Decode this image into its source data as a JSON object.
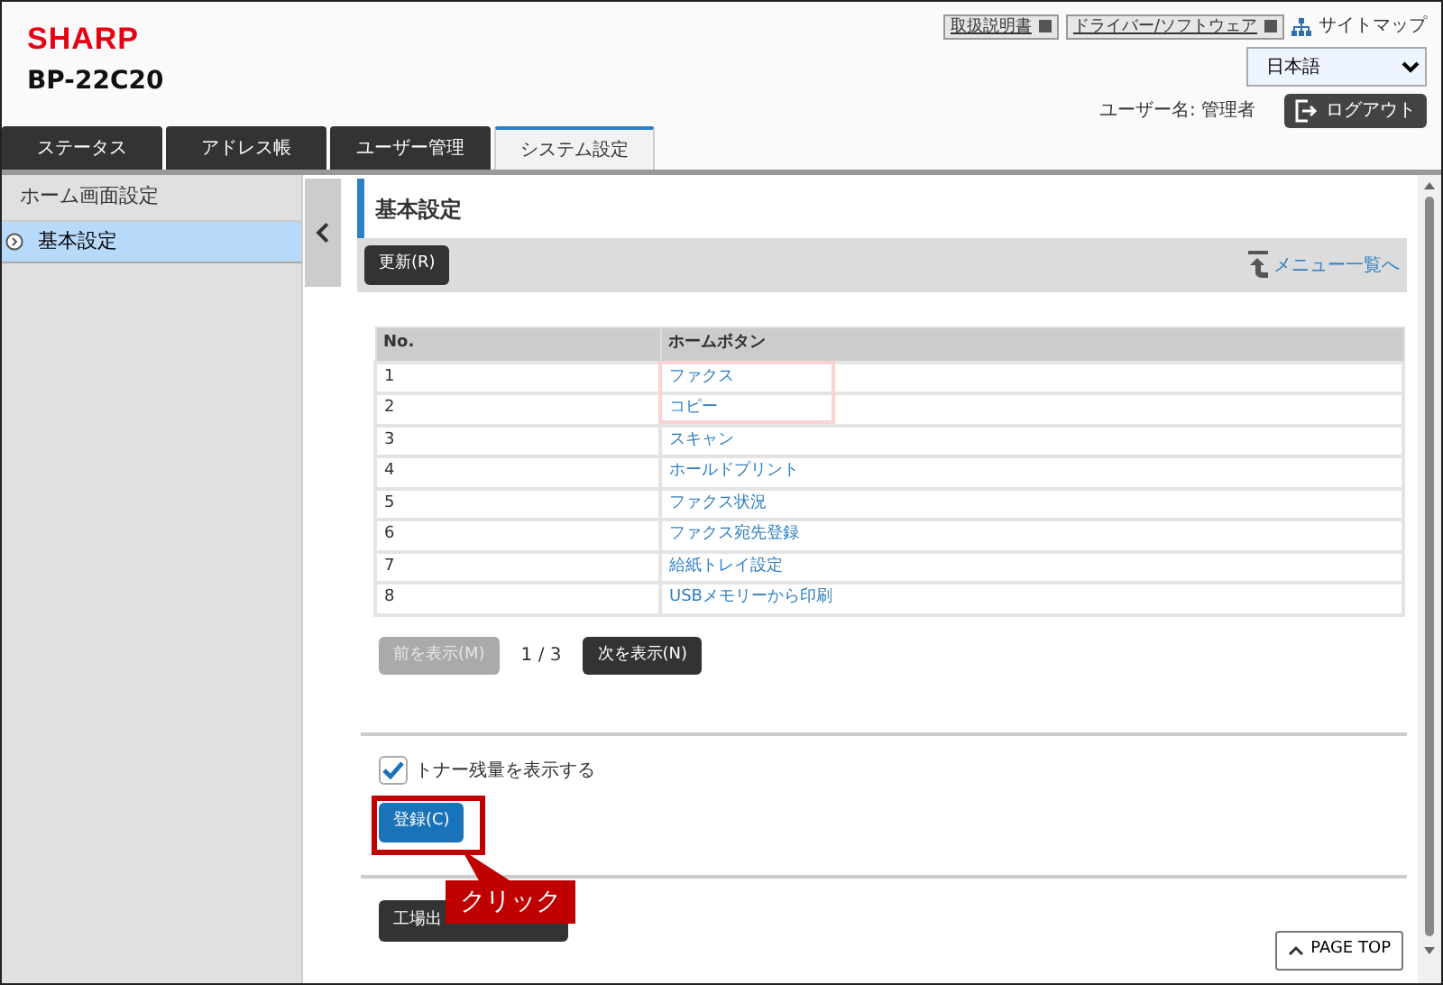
{
  "header": {
    "logo": "SHARP",
    "model": "BP-22C20",
    "links": [
      {
        "label": "取扱説明書"
      },
      {
        "label": "ドライバー/ソフトウェア"
      }
    ],
    "sitemap": "サイトマップ",
    "language": "日本語",
    "user_label": "ユーザー名: 管理者",
    "logout": "ログアウト"
  },
  "tabs": [
    {
      "label": "ステータス",
      "selected": false
    },
    {
      "label": "アドレス帳",
      "selected": false
    },
    {
      "label": "ユーザー管理",
      "selected": false
    },
    {
      "label": "システム設定",
      "selected": true
    }
  ],
  "sidebar": {
    "heading": "ホーム画面設定",
    "items": [
      {
        "label": "基本設定",
        "selected": true
      }
    ]
  },
  "page": {
    "title": "基本設定",
    "refresh": "更新(R)",
    "menu_link": "メニュー一覧へ",
    "table": {
      "columns": [
        "No.",
        "ホームボタン"
      ],
      "rows": [
        [
          "1",
          "ファクス"
        ],
        [
          "2",
          "コピー"
        ],
        [
          "3",
          "スキャン"
        ],
        [
          "4",
          "ホールドプリント"
        ],
        [
          "5",
          "ファクス状況"
        ],
        [
          "6",
          "ファクス宛先登録"
        ],
        [
          "7",
          "給紙トレイ設定"
        ],
        [
          "8",
          "USBメモリーから印刷"
        ]
      ]
    },
    "pager": {
      "prev": {
        "label": "前を表示(M)",
        "disabled": true
      },
      "page": "1 / 3",
      "next": {
        "label": "次を表示(N)",
        "disabled": false
      }
    },
    "toner_checkbox": {
      "label": "トナー残量を表示する",
      "checked": true
    },
    "submit": "登録(C)",
    "factory_button": "工場出",
    "page_top": "PAGE TOP"
  },
  "annotation": {
    "label": "クリック"
  }
}
